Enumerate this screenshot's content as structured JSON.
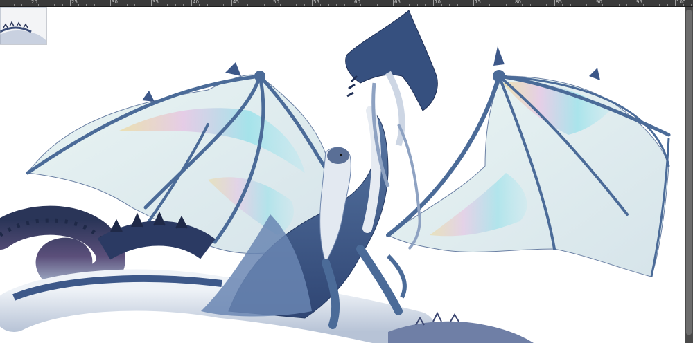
{
  "ruler": {
    "labels": [
      "20",
      "25",
      "30",
      "35",
      "40",
      "45",
      "50",
      "55",
      "60",
      "65",
      "70",
      "75",
      "80",
      "85",
      "90",
      "95",
      "100"
    ]
  },
  "canvas": {
    "background": "#ffffff",
    "artwork": "winged-dragon-illustration",
    "palette": {
      "body": "#4b6b98",
      "body_dark": "#2c3e66",
      "wing_membrane": "#dfeeee",
      "iridescent_cyan": "#7fdde8",
      "iridescent_pink": "#e7b6e0",
      "iridescent_gold": "#f0d27a",
      "belly": "#dfe5ee"
    }
  },
  "navigator": {
    "icon": "navigator-thumbnail"
  },
  "scrollbar": {
    "orientation": "vertical"
  }
}
